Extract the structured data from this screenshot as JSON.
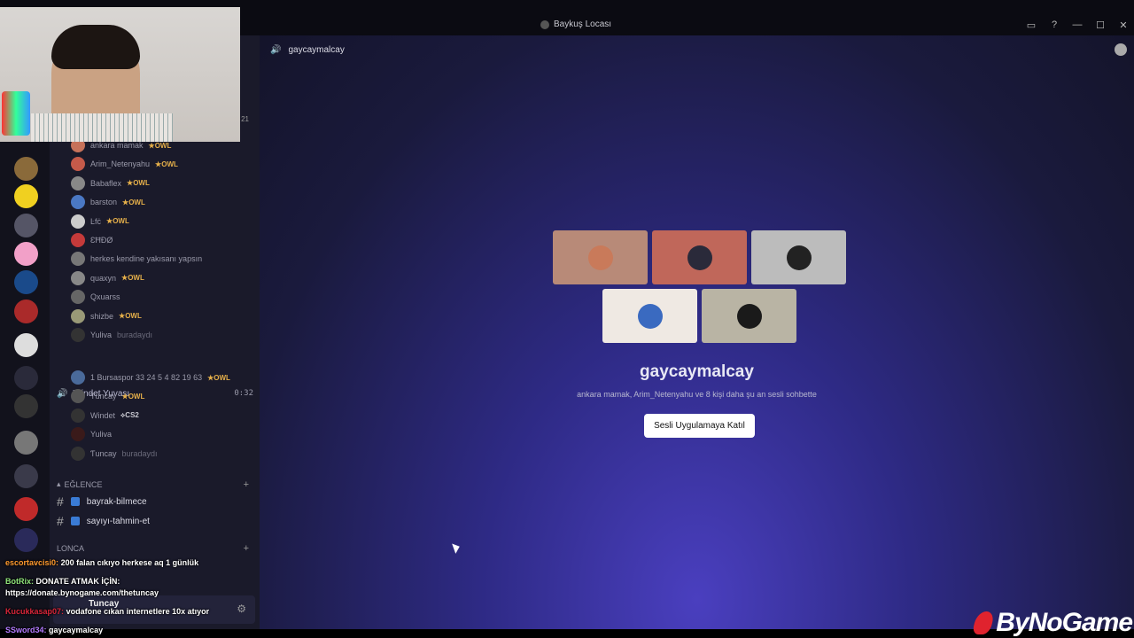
{
  "window": {
    "title": "Baykuş Locası",
    "icons": [
      "inbox-icon",
      "help-icon",
      "minimize-icon",
      "maximize-icon",
      "close-icon"
    ]
  },
  "colors": {
    "accent": "#4a3fbf",
    "owl_badge": "#e6b04a",
    "join_button": "#ffffff"
  },
  "channel_list": {
    "top_count": "21",
    "members_top": [
      {
        "name": "ankara mamak",
        "badge": "OWL",
        "color": "#c7725a"
      },
      {
        "name": "Arim_Netenyahu",
        "badge": "OWL",
        "color": "#c45a4a"
      },
      {
        "name": "Babaflex",
        "badge": "OWL",
        "color": "#888"
      },
      {
        "name": "barston",
        "badge": "OWL",
        "color": "#4a78c4"
      },
      {
        "name": "Ŀfċ",
        "badge": "OWL",
        "color": "#ccc"
      },
      {
        "name": "ƐĦĐØ",
        "badge": "",
        "color": "#c43a3a"
      },
      {
        "name": "herkes kendine yakısanı yapsın",
        "badge": "",
        "color": "#777"
      },
      {
        "name": "quaxyn",
        "badge": "OWL",
        "color": "#888"
      },
      {
        "name": "Qxuarss",
        "badge": "",
        "color": "#666"
      },
      {
        "name": "shizbe",
        "badge": "OWL",
        "color": "#997"
      },
      {
        "name": "Yuliva",
        "badge": "",
        "color": "#333",
        "suffix": "buradaydı"
      }
    ],
    "voice2": {
      "name": "Windet Yuvası",
      "time": "0:32"
    },
    "members_bottom": [
      {
        "name": "1 Bursaspor 33 24 5 4 82 19 63",
        "badge": "OWL",
        "color": "#4a6a9a"
      },
      {
        "name": "Ƭuncay",
        "badge": "OWL",
        "color": "#555"
      },
      {
        "name": "Windet",
        "badge": "CS2",
        "color": "#333"
      },
      {
        "name": "Yuliva",
        "badge": "",
        "color": "#3a1a1a"
      },
      {
        "name": "Ƭuncay",
        "badge": "",
        "color": "#333",
        "suffix": "buradaydı"
      }
    ],
    "category_fun": "EĞLENCE",
    "text_channels": [
      "bayrak-bilmece",
      "sayıyı-tahmin-et"
    ],
    "category_guild": "LONCA",
    "user_bar_name": "Tuncay"
  },
  "main": {
    "channel_name": "gaycaymalcay",
    "voice_title": "gaycaymalcay",
    "subtitle": "ankara mamak, Arim_Netenyahu ve 8 kişi daha şu an sesli sohbette",
    "join_label": "Sesli Uygulamaya Katıl",
    "tiles": [
      {
        "bg": "#b88a78",
        "av": "#c97a5a"
      },
      {
        "bg": "#c0675a",
        "av": "#2a2a3a"
      },
      {
        "bg": "#bcbcbc",
        "av": "#222"
      },
      {
        "bg": "#efe9e3",
        "av": "#3a6ac0"
      },
      {
        "bg": "#b9b4a4",
        "av": "#1a1a1a"
      }
    ]
  },
  "chat_overlay": [
    {
      "user": "escortavcisi0:",
      "msg": "200 falan cıkıyo herkese aq 1 günlük"
    },
    {
      "user": "BotRix:",
      "msg": "DONATE ATMAK İÇİN:"
    },
    {
      "user": "",
      "msg": "https://donate.bynogame.com/thetuncay"
    },
    {
      "user": "Kucukkasap07:",
      "msg": "vodafone cıkan internetlere 10x atıyor"
    },
    {
      "user": "SSword34:",
      "msg": "gaycaymalcay"
    }
  ],
  "brand": "ByNoGame"
}
